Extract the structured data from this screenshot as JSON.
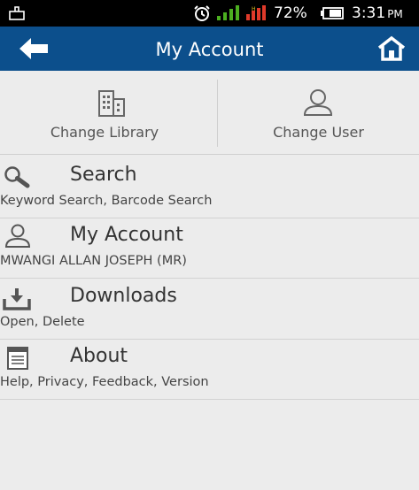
{
  "status_bar": {
    "battery_percent": "72%",
    "time": "3:31",
    "ampm": "PM"
  },
  "app_bar": {
    "title": "My Account"
  },
  "top_actions": [
    {
      "label": "Change Library"
    },
    {
      "label": "Change User"
    }
  ],
  "menu": [
    {
      "title": "Search",
      "subtitle": "Keyword Search, Barcode Search"
    },
    {
      "title": "My Account",
      "subtitle": "MWANGI ALLAN JOSEPH (MR)"
    },
    {
      "title": "Downloads",
      "subtitle": "Open, Delete"
    },
    {
      "title": "About",
      "subtitle": "Help, Privacy, Feedback, Version"
    }
  ],
  "colors": {
    "app_bar": "#0c4f8c",
    "status_bar": "#000000",
    "background": "#ececec",
    "signal_green": "#4caf20",
    "signal_red": "#e03a2a"
  }
}
